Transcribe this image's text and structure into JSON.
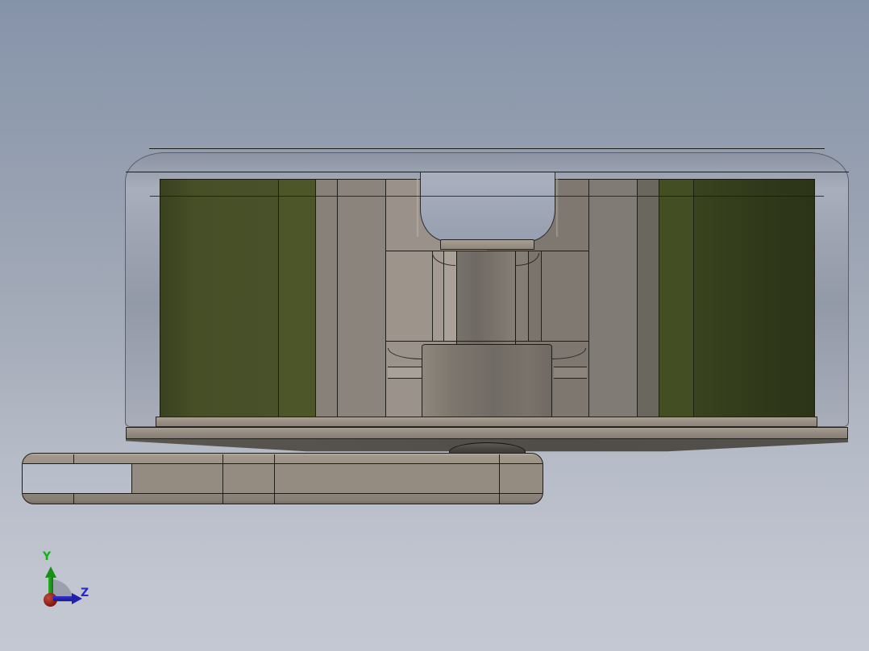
{
  "app": {
    "type": "3D CAD viewport",
    "view_description": "Side section view of a fan motor assembly with mounting arm"
  },
  "viewport": {
    "background_top": "#8593a9",
    "background_bottom": "#c3c8d2"
  },
  "triad": {
    "y_label": "Y",
    "z_label": "Z",
    "y_axis_color": "#14b314",
    "z_axis_color": "#2424c8",
    "origin_color": "#8c1d12"
  },
  "model": {
    "parts": [
      {
        "id": "rotor-housing",
        "color": "#a2a8b6",
        "finish": "translucent"
      },
      {
        "id": "stator-coil-left-outer",
        "color": "#474f27"
      },
      {
        "id": "stator-coil-left-inner",
        "color": "#4c5629"
      },
      {
        "id": "stator-coil-right-inner",
        "color": "#434e23"
      },
      {
        "id": "stator-coil-right-outer",
        "color": "#30391a"
      },
      {
        "id": "stator-core-left",
        "color": "#8a837b"
      },
      {
        "id": "stator-core-right",
        "color": "#7f7a73"
      },
      {
        "id": "bearing-tower-left",
        "color": "#99918a"
      },
      {
        "id": "bearing-tower-right",
        "color": "#7e7871"
      },
      {
        "id": "shaft",
        "color": "#77726b"
      },
      {
        "id": "shaft-cap",
        "color": "#9e968a"
      },
      {
        "id": "rotor-hub",
        "color": "#767067"
      },
      {
        "id": "base-plate-upper",
        "color": "#998f85"
      },
      {
        "id": "base-plate-lower",
        "color": "#958c82"
      },
      {
        "id": "frame-underside",
        "color": "#53504b"
      },
      {
        "id": "hub-boss",
        "color": "#46423d"
      },
      {
        "id": "mounting-arm",
        "color": "#948b81"
      }
    ]
  }
}
